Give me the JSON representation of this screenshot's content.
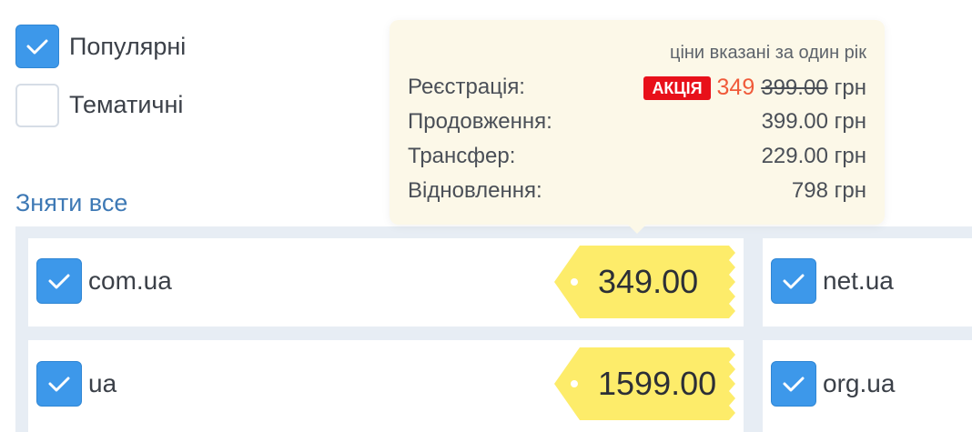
{
  "filters": [
    {
      "label": "Популярні",
      "checked": true
    },
    {
      "label": "Тематичні",
      "checked": false
    }
  ],
  "clear_all": "Зняти все",
  "tooltip": {
    "note": "ціни вказані за один рік",
    "registration": {
      "label": "Реєстрація:",
      "promo_badge": "АКЦІЯ",
      "promo_price": "349",
      "old_price": "399.00",
      "currency": "грн"
    },
    "renewal": {
      "label": "Продовження:",
      "value": "399.00 грн"
    },
    "transfer": {
      "label": "Трансфер:",
      "value": "229.00 грн"
    },
    "restore": {
      "label": "Відновлення:",
      "value": "798 грн"
    }
  },
  "domains": [
    {
      "name": "com.ua",
      "price": "349.00",
      "checked": true
    },
    {
      "name": "net.ua",
      "checked": true
    },
    {
      "name": "ua",
      "price": "1599.00",
      "checked": true
    },
    {
      "name": "org.ua",
      "checked": true
    }
  ],
  "colors": {
    "checkbox": "#3d98ea",
    "link": "#3e79b5",
    "price_tag": "#fdec6a",
    "promo_badge": "#e8101a",
    "promo_price": "#f05a3a",
    "tooltip_bg": "#fcf8e8"
  }
}
